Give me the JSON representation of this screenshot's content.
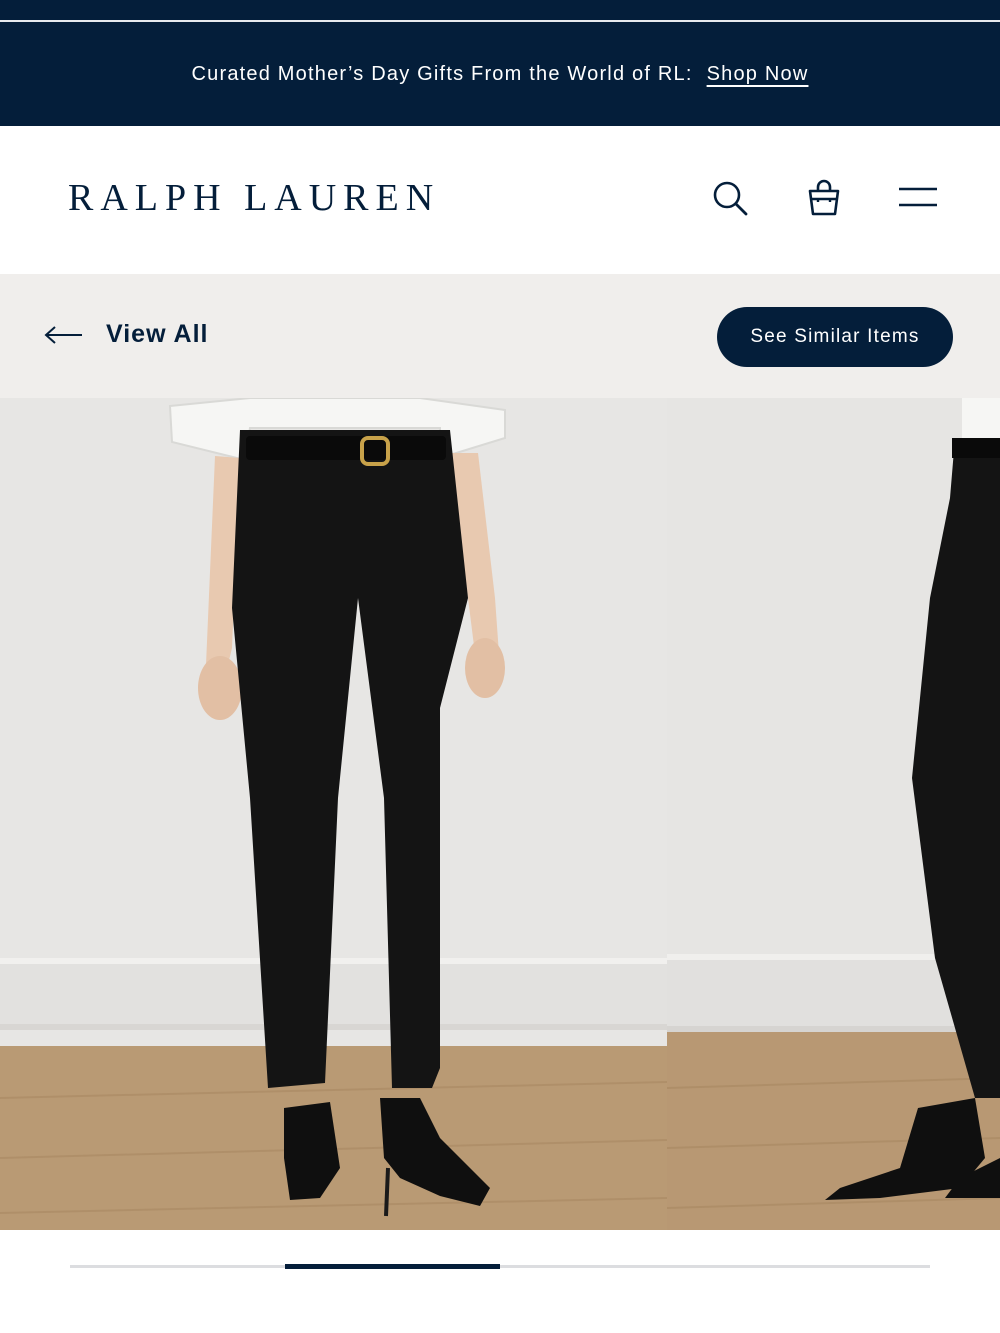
{
  "promo": {
    "text": "Curated Mother’s Day Gifts From the World of RL:",
    "link": "Shop Now"
  },
  "header": {
    "logo": "RALPH LAUREN",
    "icons": [
      "search-icon",
      "shopping-bag-icon",
      "hamburger-menu-icon"
    ]
  },
  "subnav": {
    "back_label": "View All",
    "similar_button": "See Similar Items"
  },
  "gallery": {
    "images": [
      "model-front-black-jeans",
      "model-side-black-jeans"
    ],
    "progress_fraction": 0.25,
    "active_slide": 2,
    "slide_count": 4
  },
  "colors": {
    "navy": "#041e3a",
    "subnav_bg": "#f0eeec",
    "white": "#ffffff"
  }
}
